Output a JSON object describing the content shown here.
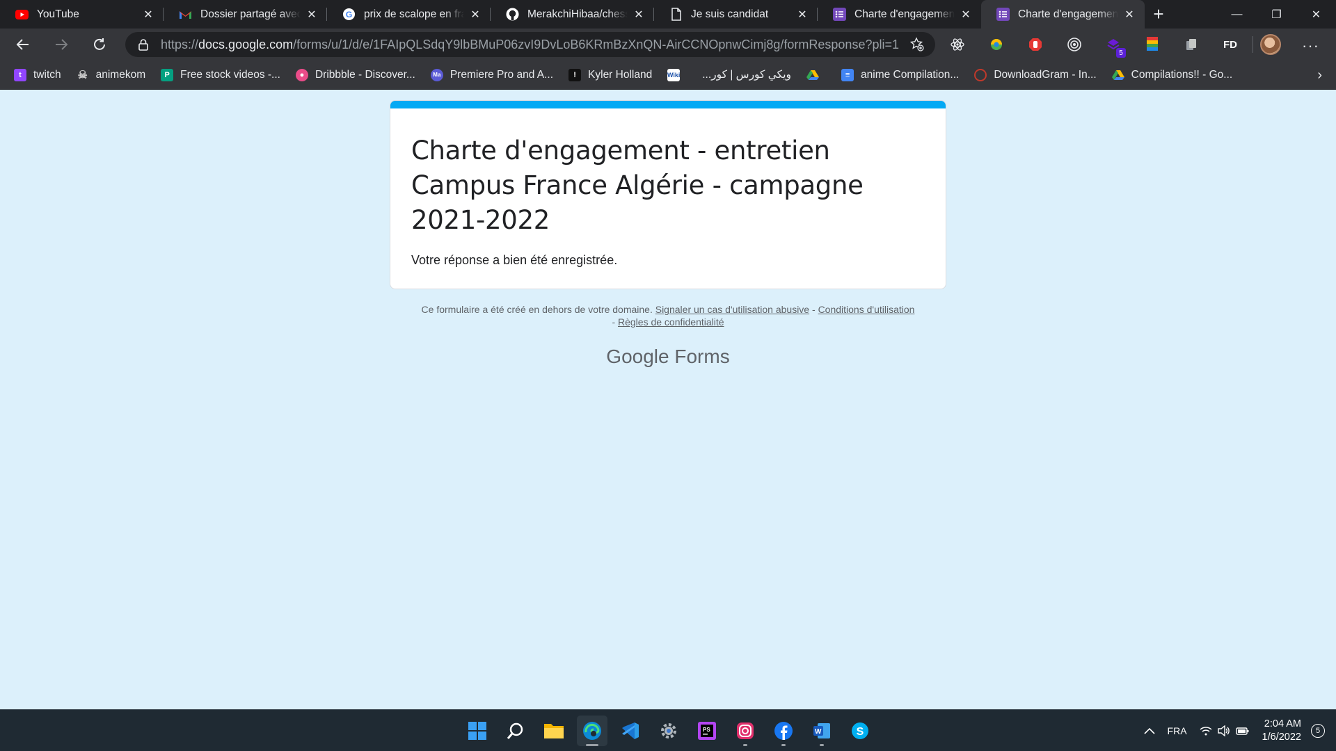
{
  "browser": {
    "tabs": [
      {
        "title": "YouTube",
        "icon": "youtube-icon"
      },
      {
        "title": "Dossier partagé avec vous",
        "icon": "gmail-icon"
      },
      {
        "title": "prix de scalope en france",
        "icon": "google-icon"
      },
      {
        "title": "MerakchiHibaa/chess-game",
        "icon": "github-icon"
      },
      {
        "title": "Je suis candidat",
        "icon": "document-icon"
      },
      {
        "title": "Charte d'engagement - entretien",
        "icon": "google-forms-icon"
      },
      {
        "title": "Charte d'engagement - entretien",
        "icon": "google-forms-icon",
        "active": true
      }
    ],
    "address": {
      "prefix": "https://",
      "host": "docs.google.com",
      "path": "/forms/u/1/d/e/1FAIpQLSdqY9lbBMuP06zvI9DvLoB6KRmBzXnQN-AirCCNOpnwCimj8g/formResponse?pli=1"
    },
    "extensions": [
      "react-devtools-icon",
      "color-extension-icon",
      "adblock-icon",
      "record-icon",
      "extension-badge-icon",
      "colorzilla-icon",
      "copy-icon",
      "fd-icon"
    ],
    "extension_badge": "5",
    "extension_fd": "FD",
    "bookmarks": [
      {
        "label": "twitch",
        "icon": "twitch-icon",
        "color": "#9146ff"
      },
      {
        "label": "animekom",
        "icon": "animekom-icon",
        "color": "#555555"
      },
      {
        "label": "Free stock videos -...",
        "icon": "pexels-icon",
        "color": "#05a081"
      },
      {
        "label": "Dribbble - Discover...",
        "icon": "dribbble-icon",
        "color": "#ea4c89"
      },
      {
        "label": "Premiere Pro and A...",
        "icon": "premiere-icon",
        "color": "#5b5bd6"
      },
      {
        "label": "Kyler Holland",
        "icon": "kyler-icon",
        "color": "#111111"
      },
      {
        "label": "",
        "icon": "wiki-icon",
        "color": "#ffffff"
      },
      {
        "label": "ويكي كورس | كور...",
        "icon": "wiki-course-icon",
        "color": "#ffffff"
      },
      {
        "label": "",
        "icon": "drive-icon",
        "color": "#34a853"
      },
      {
        "label": "anime Compilation...",
        "icon": "docs-icon",
        "color": "#4285f4"
      },
      {
        "label": "DownloadGram - In...",
        "icon": "downloadgram-icon",
        "color": "#e04040"
      },
      {
        "label": "Compilations!! - Go...",
        "icon": "drive-icon",
        "color": "#fbbc04"
      }
    ]
  },
  "form": {
    "title": "Charte d'engagement - entretien Campus France Algérie - campagne 2021-2022",
    "confirmation": "Votre réponse a bien été enregistrée.",
    "accent_color": "#03a9f4",
    "footer": {
      "text": "Ce formulaire a été créé en dehors de votre domaine.",
      "link_abuse": "Signaler un cas d'utilisation abusive",
      "link_terms": "Conditions d'utilisation",
      "link_privacy": "Règles de confidentialité",
      "separator": "-"
    },
    "logo_google": "Google",
    "logo_forms": "Forms"
  },
  "taskbar": {
    "apps": [
      "windows-start-icon",
      "search-icon",
      "file-explorer-icon",
      "edge-icon",
      "vscode-icon",
      "settings-icon",
      "phpstorm-icon",
      "instagram-icon",
      "facebook-icon",
      "word-icon",
      "skype-icon"
    ],
    "language": "FRA",
    "time": "2:04 AM",
    "date": "1/6/2022",
    "notifications": "5"
  }
}
